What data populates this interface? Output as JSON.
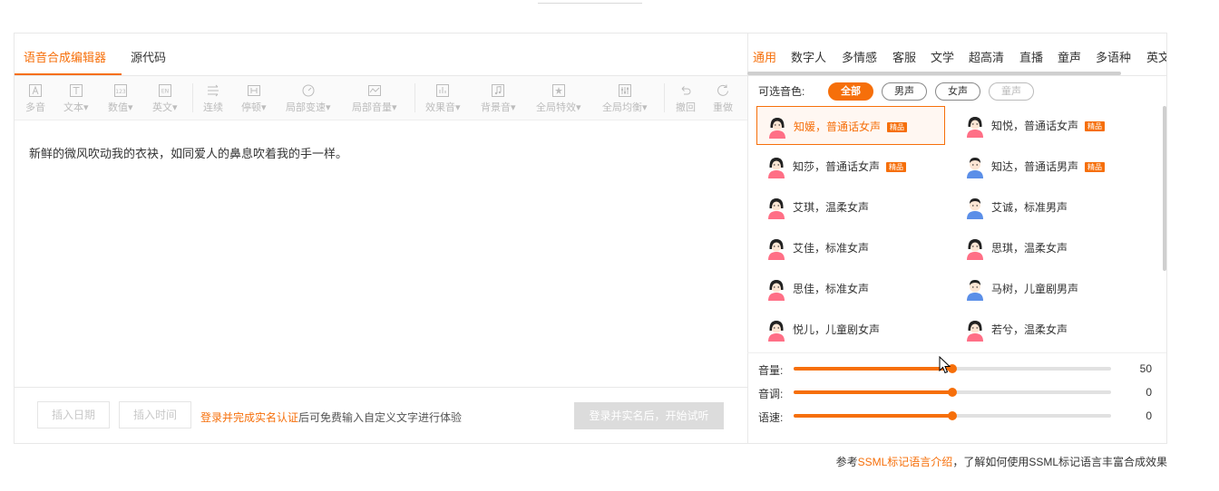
{
  "editor": {
    "tabs": [
      {
        "label": "语音合成编辑器",
        "active": true
      },
      {
        "label": "源代码",
        "active": false
      }
    ],
    "toolbar": [
      {
        "label": "多音",
        "icon": "character-a-icon"
      },
      {
        "label": "文本▾",
        "icon": "text-t-icon"
      },
      {
        "label": "数值▾",
        "icon": "number-123-icon"
      },
      {
        "label": "英文▾",
        "icon": "english-en-icon"
      },
      {
        "label": "连续",
        "icon": "continuous-icon"
      },
      {
        "label": "停顿▾",
        "icon": "pause-icon"
      },
      {
        "label": "局部变速▾",
        "icon": "speed-gauge-icon"
      },
      {
        "label": "局部音量▾",
        "icon": "volume-wave-icon"
      },
      {
        "label": "效果音▾",
        "icon": "effect-bars-icon"
      },
      {
        "label": "背景音▾",
        "icon": "music-note-icon"
      },
      {
        "label": "全局特效▾",
        "icon": "star-icon"
      },
      {
        "label": "全局均衡▾",
        "icon": "equalizer-icon"
      },
      {
        "label": "撤回",
        "icon": "undo-icon"
      },
      {
        "label": "重做",
        "icon": "redo-icon"
      }
    ],
    "content": "新鲜的微风吹动我的衣袂，如同爱人的鼻息吹着我的手一样。",
    "bottom": {
      "insert_date": "插入日期",
      "insert_time": "插入时间",
      "hint_link": "登录并完成实名认证",
      "hint_rest": "后可免费输入自定义文字进行体验",
      "try_button": "登录并实名后，开始试听"
    }
  },
  "voices": {
    "categories": [
      {
        "label": "通用",
        "active": true
      },
      {
        "label": "数字人"
      },
      {
        "label": "多情感"
      },
      {
        "label": "客服"
      },
      {
        "label": "文学"
      },
      {
        "label": "超高清"
      },
      {
        "label": "直播"
      },
      {
        "label": "童声"
      },
      {
        "label": "多语种"
      },
      {
        "label": "英文"
      }
    ],
    "filter_label": "可选音色:",
    "filters": [
      {
        "label": "全部",
        "state": "active"
      },
      {
        "label": "男声",
        "state": "normal"
      },
      {
        "label": "女声",
        "state": "normal"
      },
      {
        "label": "童声",
        "state": "disabled"
      }
    ],
    "premium_badge": "精品",
    "list": [
      {
        "name": "知媛，普通话女声",
        "premium": true,
        "gender": "female",
        "selected": true
      },
      {
        "name": "知悦，普通话女声",
        "premium": true,
        "gender": "female"
      },
      {
        "name": "知莎，普通话女声",
        "premium": true,
        "gender": "female"
      },
      {
        "name": "知达，普通话男声",
        "premium": true,
        "gender": "male-short-hair"
      },
      {
        "name": "艾琪，温柔女声",
        "premium": false,
        "gender": "female"
      },
      {
        "name": "艾诚，标准男声",
        "premium": false,
        "gender": "male"
      },
      {
        "name": "艾佳，标准女声",
        "premium": false,
        "gender": "female"
      },
      {
        "name": "思琪，温柔女声",
        "premium": false,
        "gender": "female"
      },
      {
        "name": "思佳，标准女声",
        "premium": false,
        "gender": "female"
      },
      {
        "name": "马树，儿童剧男声",
        "premium": false,
        "gender": "male"
      },
      {
        "name": "悦儿，儿童剧女声",
        "premium": false,
        "gender": "female"
      },
      {
        "name": "若兮，温柔女声",
        "premium": false,
        "gender": "female"
      }
    ]
  },
  "sliders": [
    {
      "label": "音量:",
      "value": "50",
      "fraction": 0.5
    },
    {
      "label": "音调:",
      "value": "0",
      "fraction": 0.5
    },
    {
      "label": "语速:",
      "value": "0",
      "fraction": 0.5
    }
  ],
  "footer": {
    "prefix": "参考",
    "link": "SSML标记语言介绍",
    "suffix": "，了解如何使用SSML标记语言丰富合成效果"
  },
  "colors": {
    "accent": "#f66f0a",
    "female_shirt": "#ff6f86",
    "male_shirt": "#5b8fe8"
  }
}
